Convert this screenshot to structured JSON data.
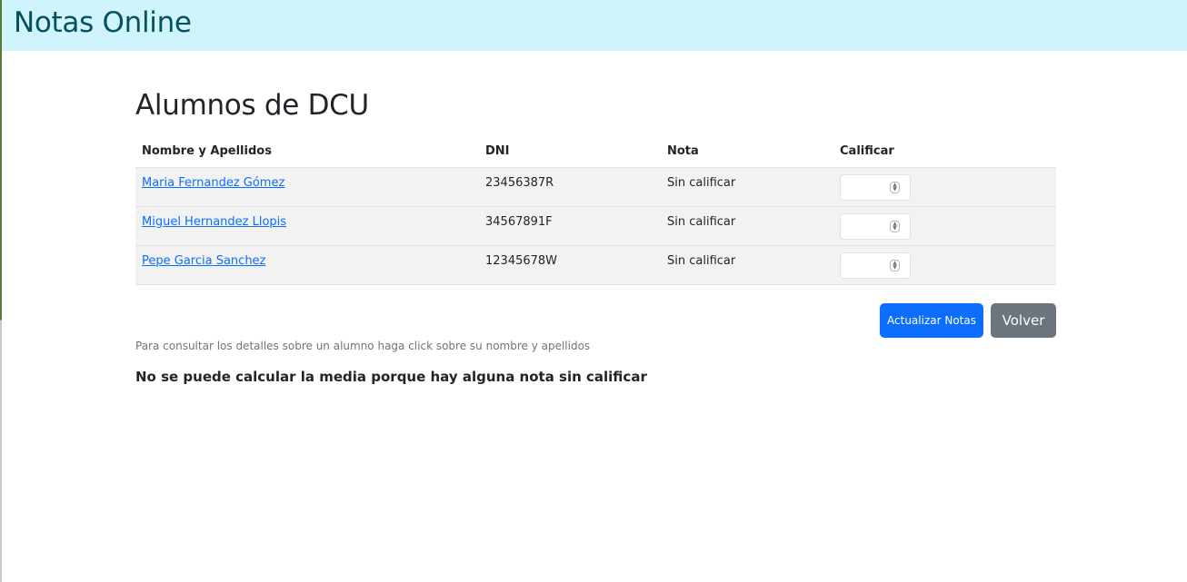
{
  "navbar": {
    "brand": "Notas Online"
  },
  "page": {
    "title": "Alumnos de DCU"
  },
  "table": {
    "headers": {
      "name": "Nombre y Apellidos",
      "dni": "DNI",
      "grade": "Nota",
      "grade_input": "Calificar"
    },
    "rows": [
      {
        "name": "Maria Fernandez Gómez",
        "dni": "23456387R",
        "grade": "Sin calificar",
        "input_value": ""
      },
      {
        "name": "Miguel Hernandez Llopis",
        "dni": "34567891F",
        "grade": "Sin calificar",
        "input_value": ""
      },
      {
        "name": "Pepe Garcia Sanchez",
        "dni": "12345678W",
        "grade": "Sin calificar",
        "input_value": ""
      }
    ]
  },
  "actions": {
    "update_label": "Actualizar Notas",
    "back_label": "Volver"
  },
  "hint": "Para consultar los detalles sobre un alumno haga click sobre su nombre y apellidos",
  "average_message": "No se puede calcular la media porque hay alguna nota sin calificar",
  "colors": {
    "navbar_bg": "#cff4fc",
    "brand": "#055160",
    "link": "#0d6efd",
    "primary": "#0d6efd",
    "secondary": "#6c757d",
    "row_bg": "#f2f2f2"
  }
}
